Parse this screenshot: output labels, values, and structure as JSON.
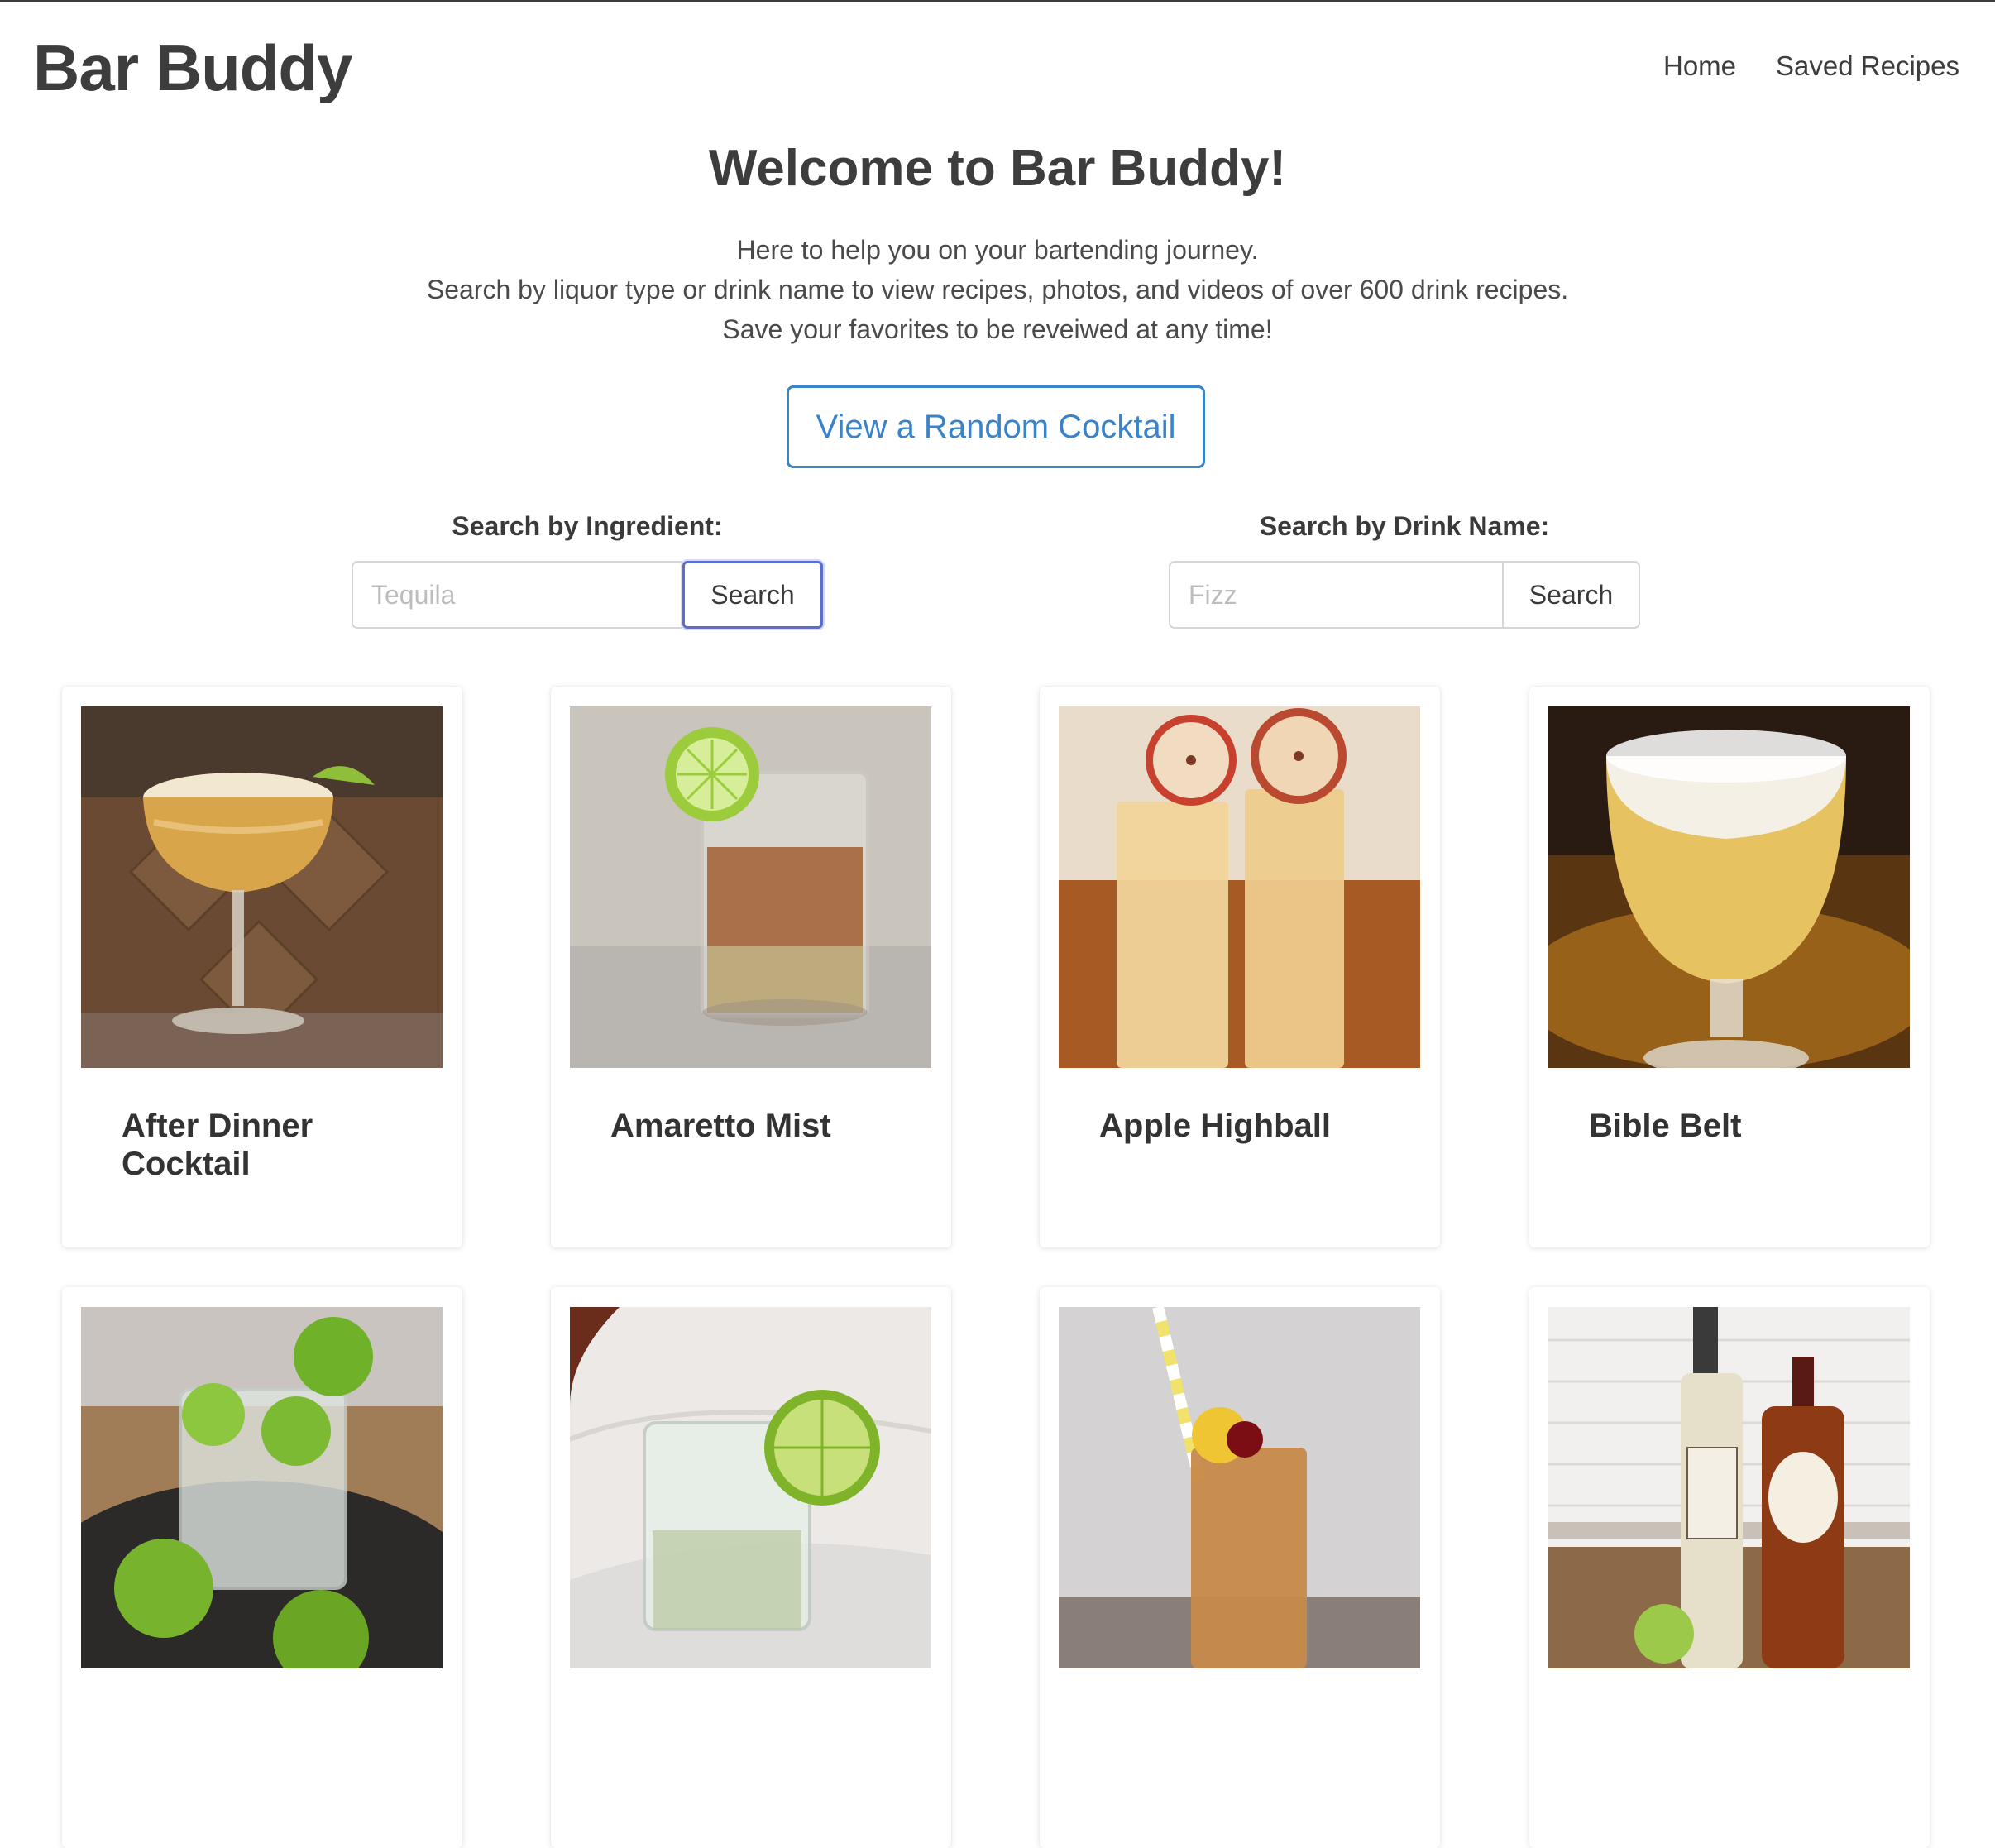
{
  "header": {
    "brand": "Bar Buddy",
    "nav": [
      "Home",
      "Saved Recipes"
    ]
  },
  "hero": {
    "title": "Welcome to Bar Buddy!",
    "lines": [
      "Here to help you on your bartending journey.",
      "Search by liquor type or drink name to view recipes, photos, and videos of over 600 drink recipes.",
      "Save your favorites to be reveiwed at any time!"
    ],
    "random_button": "View a Random Cocktail"
  },
  "search": {
    "ingredient": {
      "label": "Search by Ingredient:",
      "placeholder": "Tequila",
      "button": "Search"
    },
    "name": {
      "label": "Search by Drink Name:",
      "placeholder": "Fizz",
      "button": "Search"
    }
  },
  "cards": [
    {
      "title": "After Dinner Cocktail",
      "image": "coupe-cocktail-photo"
    },
    {
      "title": "Amaretto Mist",
      "image": "lowball-amber-drink-photo"
    },
    {
      "title": "Apple Highball",
      "image": "two-highballs-apple-chips-photo"
    },
    {
      "title": "Bible Belt",
      "image": "frothy-goblet-drink-photo"
    },
    {
      "title": "",
      "image": "gin-lime-rocks-photo"
    },
    {
      "title": "",
      "image": "lime-wheel-rocks-glass-photo"
    },
    {
      "title": "",
      "image": "tall-drink-cherry-straw-photo"
    },
    {
      "title": "",
      "image": "liquor-bottles-photo"
    }
  ]
}
